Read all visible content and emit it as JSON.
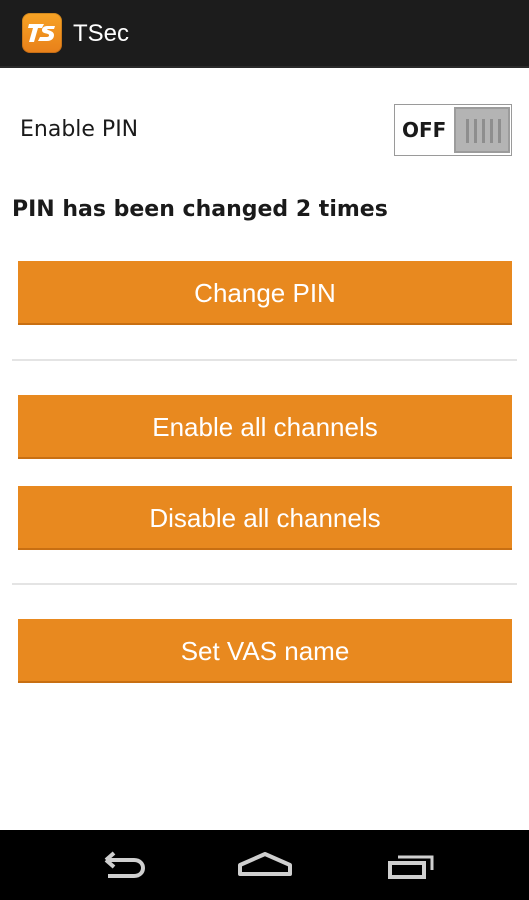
{
  "app": {
    "title": "TSec",
    "icon": "tsec-app-icon",
    "accent_color": "#e8891f"
  },
  "settings": {
    "enable_pin_label": "Enable PIN",
    "pin_toggle": {
      "state_label": "OFF",
      "checked": false
    },
    "pin_change_counter": "PIN has been changed 2 times"
  },
  "buttons": {
    "change_pin": "Change PIN",
    "enable_all_channels": "Enable all channels",
    "disable_all_channels": "Disable all channels",
    "set_vas_name": "Set VAS name"
  },
  "navigation": {
    "back_icon": "back-icon",
    "home_icon": "home-icon",
    "recents_icon": "recents-icon"
  }
}
